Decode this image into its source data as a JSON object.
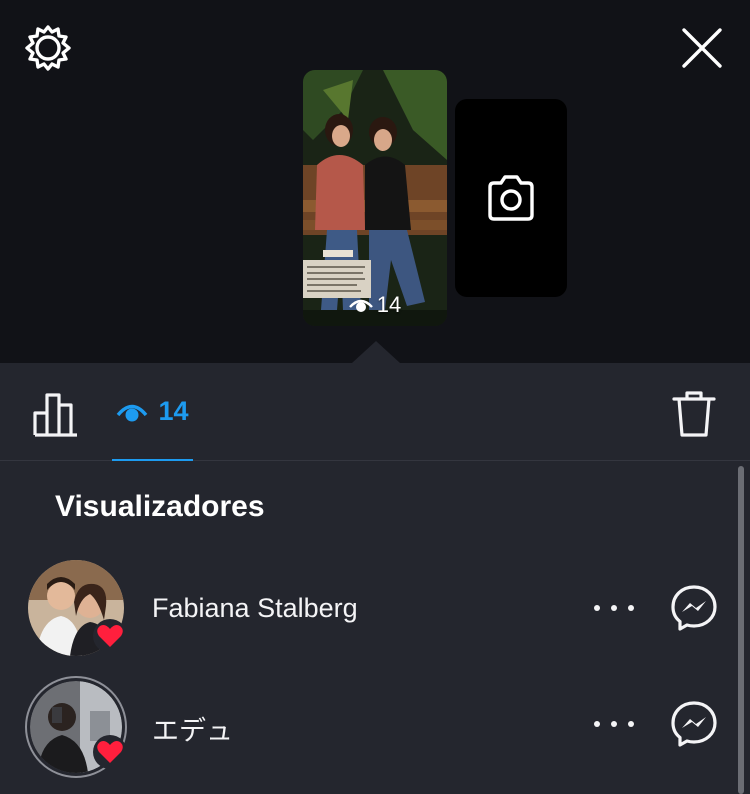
{
  "top": {
    "settings_icon": "gear-icon",
    "close_icon": "close-icon",
    "story_thumbnail": {
      "view_count": "14"
    },
    "camera_card_icon": "camera-icon"
  },
  "tabs": {
    "insights_icon": "bar-chart-icon",
    "views": {
      "icon": "eye-icon",
      "count": "14",
      "active_color": "#1d9bf0"
    },
    "delete_icon": "trash-icon"
  },
  "viewers_section": {
    "title": "Visualizadores",
    "viewers": [
      {
        "name": "Fabiana Stalberg",
        "liked": true
      },
      {
        "name": "エデュ",
        "liked": true
      }
    ]
  },
  "colors": {
    "background_top": "#111217",
    "sheet": "#24262e",
    "accent": "#1d9bf0",
    "heart": "#ff1f3d"
  }
}
